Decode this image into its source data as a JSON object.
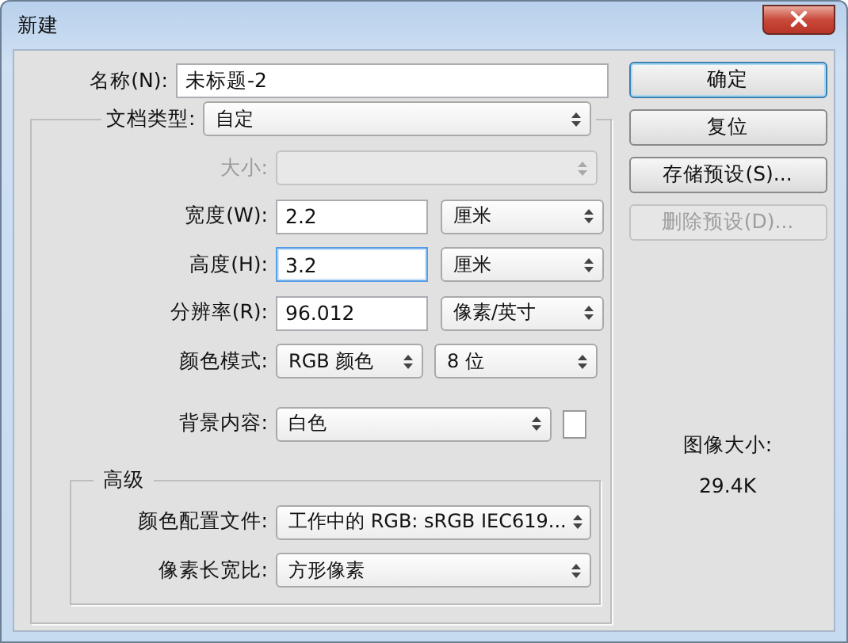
{
  "window": {
    "title": "新建"
  },
  "name": {
    "label": "名称(N):",
    "value": "未标题-2"
  },
  "buttons": [
    {
      "label": "确定",
      "disabled": false,
      "default": true
    },
    {
      "label": "复位",
      "disabled": false,
      "default": false
    },
    {
      "label": "存储预设(S)...",
      "disabled": false,
      "default": false
    },
    {
      "label": "删除预设(D)...",
      "disabled": true,
      "default": false
    }
  ],
  "document_type": {
    "label": "文档类型:",
    "value": "自定"
  },
  "fields": [
    {
      "kind": "select",
      "label": "大小:",
      "disabled": true
    },
    {
      "kind": "input-unit",
      "label": "宽度(W):",
      "value": "2.2",
      "unit": "厘米",
      "focused": false,
      "disabled": false
    },
    {
      "kind": "input-unit",
      "label": "高度(H):",
      "value": "3.2",
      "unit": "厘米",
      "focused": true,
      "disabled": false
    },
    {
      "kind": "input-unit",
      "label": "分辨率(R):",
      "value": "96.012",
      "unit": "像素/英寸",
      "focused": false,
      "disabled": false
    },
    {
      "kind": "select-pair",
      "label": "颜色模式:",
      "value": "RGB 颜色",
      "second": "8 位",
      "disabled": false
    },
    {
      "kind": "select-swatch",
      "label": "背景内容:",
      "value": "白色",
      "disabled": false
    }
  ],
  "advanced": {
    "title": "高级",
    "fields": [
      {
        "kind": "select",
        "label": "颜色配置文件:",
        "value": "工作中的 RGB: sRGB IEC619...",
        "disabled": false
      },
      {
        "kind": "select",
        "label": "像素长宽比:",
        "value": "方形像素",
        "disabled": false
      }
    ]
  },
  "image_size": {
    "label": "图像大小:",
    "value": "29.4K"
  }
}
